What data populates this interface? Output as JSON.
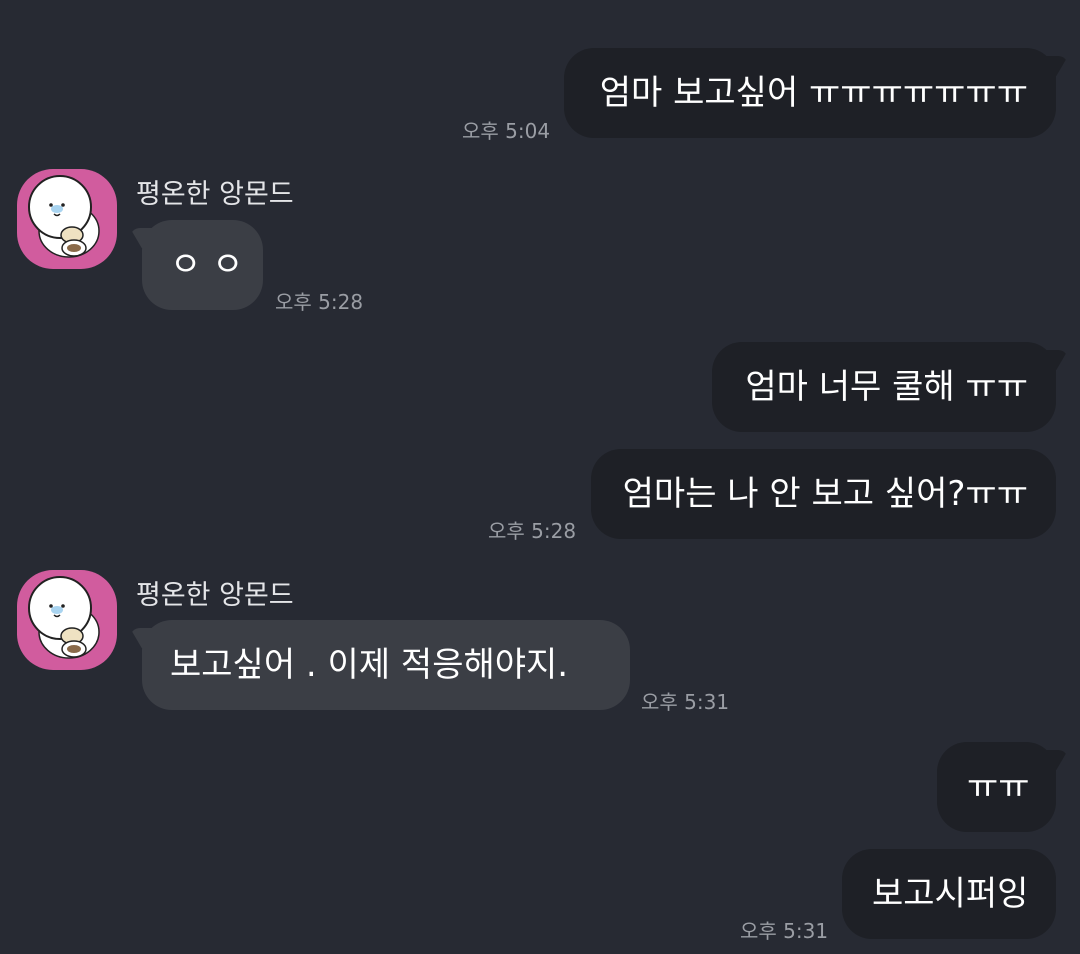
{
  "colors": {
    "background": "#272a33",
    "sent_bubble": "#1e2026",
    "received_bubble": "#3b3e45",
    "avatar_background": "#d15c9e",
    "timestamp": "#9a9da4"
  },
  "contact": {
    "name": "평온한 앙몬드",
    "avatar_icon": "white-character-avatar-icon"
  },
  "messages": [
    {
      "direction": "sent",
      "text": "엄마 보고싶어 ㅠㅠㅠㅠㅠㅠㅠ",
      "time": "오후 5:04"
    },
    {
      "direction": "received",
      "sender": "평온한 앙몬드",
      "text": "ㅇ ㅇ",
      "time": "오후 5:28"
    },
    {
      "direction": "sent",
      "text": "엄마 너무 쿨해 ㅠㅠ",
      "time": ""
    },
    {
      "direction": "sent",
      "text": "엄마는 나 안 보고 싶어?ㅠㅠ",
      "time": "오후 5:28"
    },
    {
      "direction": "received",
      "sender": "평온한 앙몬드",
      "text": "보고싶어 .  이제 적응해야지.",
      "time": "오후 5:31"
    },
    {
      "direction": "sent",
      "text": "ㅠㅠ",
      "time": ""
    },
    {
      "direction": "sent",
      "text": "보고시퍼잉",
      "time": "오후 5:31"
    }
  ]
}
